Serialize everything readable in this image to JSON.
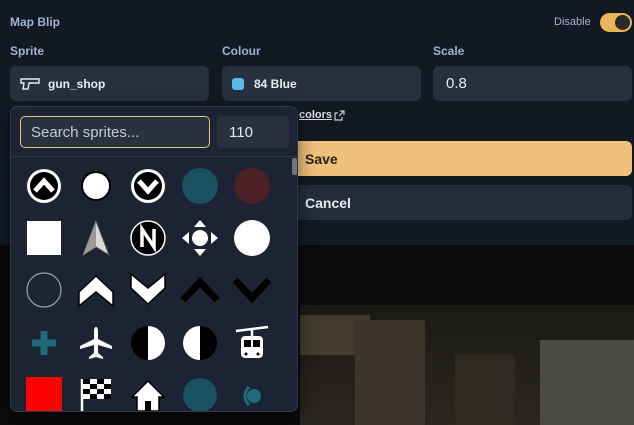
{
  "header": {
    "title": "Map Blip",
    "disable_label": "Disable",
    "disable_on": true
  },
  "fields": {
    "sprite": {
      "label": "Sprite",
      "value": "gun_shop",
      "icon": "pistol-icon"
    },
    "colour": {
      "label": "Colour",
      "value": "84 Blue",
      "swatch": "#5cb8e8"
    },
    "scale": {
      "label": "Scale",
      "value": "0.8"
    }
  },
  "colors_link": "colors",
  "buttons": {
    "save": "Save",
    "cancel": "Cancel"
  },
  "picker": {
    "search_placeholder": "Search sprites...",
    "count": "110",
    "sprites": [
      "chevron-up-circle-icon",
      "white-circle-icon",
      "chevron-down-circle-icon",
      "teal-circle-icon",
      "dark-red-circle-icon",
      "white-square-icon",
      "north-arrow-icon",
      "north-n-icon",
      "dpad-arrows-icon",
      "large-white-circle-icon",
      "circle-outline-icon",
      "chevron-up-icon",
      "chevron-down-icon",
      "thin-chevron-up-icon",
      "thin-chevron-down-icon",
      "plus-icon",
      "airplane-icon",
      "half-circle-left-icon",
      "half-circle-right-icon",
      "cable-car-icon",
      "red-square-icon",
      "checkered-flag-icon",
      "house-icon",
      "teal-dot-icon",
      "teal-signal-icon"
    ]
  },
  "colors": {
    "accent": "#eab55a",
    "save": "#eec07b",
    "panel": "#131923",
    "field": "#27303f"
  }
}
